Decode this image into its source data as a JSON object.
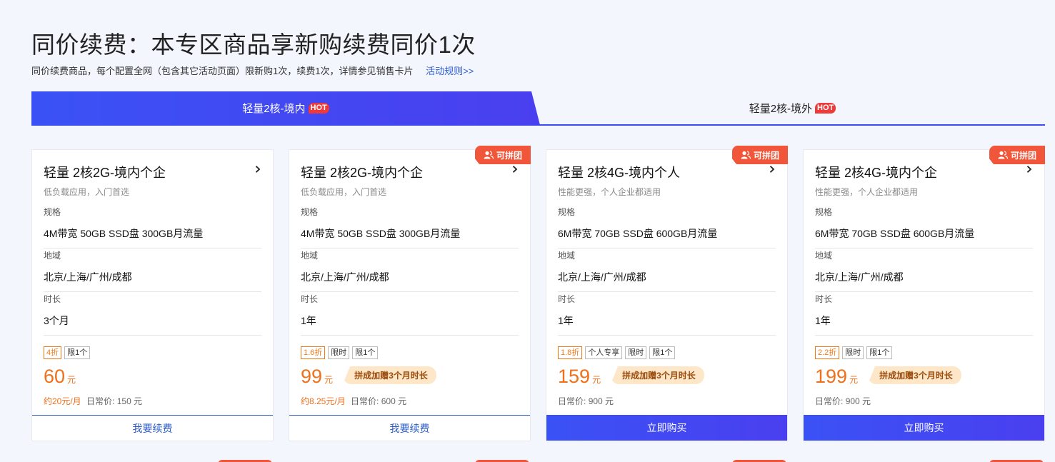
{
  "header": {
    "title": "同价续费：本专区商品享新购续费同价1次",
    "subtitle": "同价续费商品，每个配置全网（包含其它活动页面）限新购1次，续费1次，详情参见销售卡片",
    "rules_link": "活动规则>>"
  },
  "tabs": [
    {
      "label": "轻量2核-境内",
      "badge": "HOT",
      "active": true
    },
    {
      "label": "轻量2核-境外",
      "badge": "HOT",
      "active": false
    }
  ],
  "labels": {
    "spec": "规格",
    "region": "地域",
    "duration": "时长",
    "usual_price_prefix": "日常价:",
    "unit": "元",
    "group_badge": "可拼团"
  },
  "cards": [
    {
      "name": "轻量 2核2G-境内个企",
      "desc": "低负载应用，入门首选",
      "spec": "4M带宽 50GB SSD盘 300GB月流量",
      "region": "北京/上海/广州/成都",
      "duration": "3个月",
      "tags": [
        "4折",
        "限1个"
      ],
      "price": "60",
      "per_month": "约20元/月",
      "usual_price": "150 元",
      "bonus": "",
      "group": false,
      "button": "我要续费"
    },
    {
      "name": "轻量 2核2G-境内个企",
      "desc": "低负载应用，入门首选",
      "spec": "4M带宽 50GB SSD盘 300GB月流量",
      "region": "北京/上海/广州/成都",
      "duration": "1年",
      "tags": [
        "1.6折",
        "限时",
        "限1个"
      ],
      "price": "99",
      "per_month": "约8.25元/月",
      "usual_price": "600 元",
      "bonus": "拼成加赠3个月时长",
      "group": true,
      "button": "我要续费"
    },
    {
      "name": "轻量 2核4G-境内个人",
      "desc": "性能更强，个人企业都适用",
      "spec": "6M带宽 70GB SSD盘 600GB月流量",
      "region": "北京/上海/广州/成都",
      "duration": "1年",
      "tags": [
        "1.8折",
        "个人专享",
        "限时",
        "限1个"
      ],
      "price": "159",
      "per_month": "",
      "usual_price": "900 元",
      "bonus": "拼成加赠3个月时长",
      "group": true,
      "button": "立即购买"
    },
    {
      "name": "轻量 2核4G-境内个企",
      "desc": "性能更强，个人企业都适用",
      "spec": "6M带宽 70GB SSD盘 600GB月流量",
      "region": "北京/上海/广州/成都",
      "duration": "1年",
      "tags": [
        "2.2折",
        "限时",
        "限1个"
      ],
      "price": "199",
      "per_month": "",
      "usual_price": "900 元",
      "bonus": "拼成加赠3个月时长",
      "group": true,
      "button": "立即购买"
    }
  ]
}
